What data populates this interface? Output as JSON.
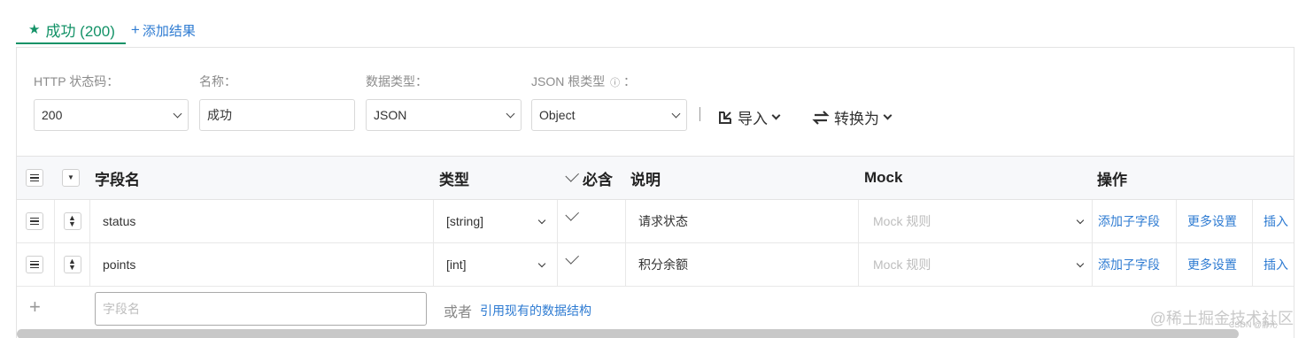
{
  "tabs": {
    "active": {
      "icon": "star-icon",
      "label": "成功 (200)"
    },
    "add": {
      "icon": "plus-icon",
      "label": "添加结果"
    }
  },
  "form": {
    "status_code": {
      "label": "HTTP 状态码：",
      "value": "200"
    },
    "name": {
      "label": "名称：",
      "value": "成功"
    },
    "data_type": {
      "label": "数据类型：",
      "value": "JSON"
    },
    "json_root_type": {
      "label": "JSON 根类型",
      "label_suffix": "：",
      "info_icon": "ⓘ",
      "value": "Object"
    },
    "import_button": {
      "label": "导入"
    },
    "convert_button": {
      "label": "转换为"
    }
  },
  "table": {
    "headers": {
      "field_name": "字段名",
      "type": "类型",
      "required": "必含",
      "description": "说明",
      "mock": "Mock",
      "actions": "操作"
    },
    "rows": [
      {
        "name": "status",
        "type": "[string]",
        "required": true,
        "description": "请求状态",
        "mock_placeholder": "Mock 规则",
        "action_add_child": "添加子字段",
        "action_more": "更多设置",
        "action_insert": "插入"
      },
      {
        "name": "points",
        "type": "[int]",
        "required": true,
        "description": "积分余额",
        "mock_placeholder": "Mock 规则",
        "action_add_child": "添加子字段",
        "action_more": "更多设置",
        "action_insert": "插入"
      }
    ],
    "new_row": {
      "add_symbol": "+",
      "field_placeholder": "字段名",
      "or_text": "或者",
      "reference_link": "引用现有的数据结构"
    }
  },
  "watermark": {
    "main": "@稀土掘金技术社区",
    "small": "CSDN @静沁"
  },
  "colors": {
    "accent_green": "#139267",
    "link_blue": "#2e7bd2"
  }
}
